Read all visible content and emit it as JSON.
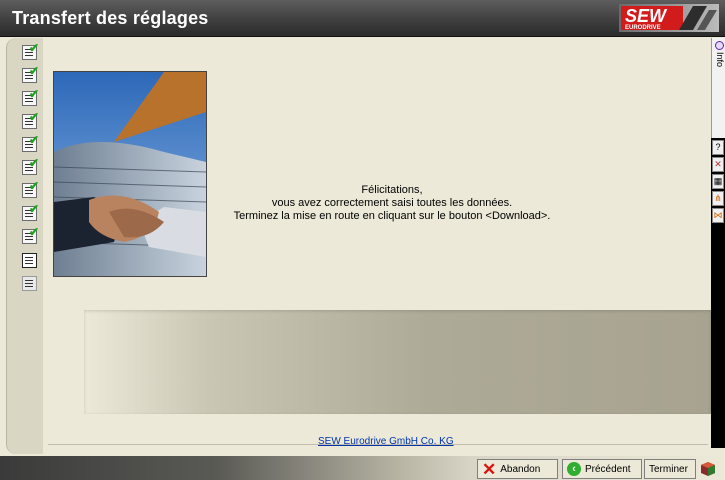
{
  "window": {
    "title": "Transfert des réglages",
    "brand_main": "SEW",
    "brand_sub": "EURODRIVE"
  },
  "steps": [
    {
      "state": "done"
    },
    {
      "state": "done"
    },
    {
      "state": "done"
    },
    {
      "state": "done"
    },
    {
      "state": "done"
    },
    {
      "state": "done"
    },
    {
      "state": "done"
    },
    {
      "state": "done"
    },
    {
      "state": "done"
    },
    {
      "state": "current"
    },
    {
      "state": "pending"
    }
  ],
  "message": {
    "line1": "Félicitations,",
    "line2": "vous avez correctement saisi toutes les données.",
    "line3": "Terminez la mise en route en cliquant sur le bouton <Download>."
  },
  "footer": {
    "company_link": "SEW Eurodrive GmbH  Co. KG"
  },
  "right_panel": {
    "info_label": "Info",
    "help_icon": "?",
    "tools": [
      "help-icon",
      "close-doc-icon",
      "table-icon",
      "network-icon",
      "tree-icon"
    ]
  },
  "buttons": {
    "abort_label": "Abandon",
    "previous_label": "Précédent",
    "finish_label": "Terminer"
  },
  "colors": {
    "title_bar": "#3f3f3f",
    "background": "#ece9d8",
    "link": "#0033aa",
    "brand_red": "#d21b1b"
  }
}
